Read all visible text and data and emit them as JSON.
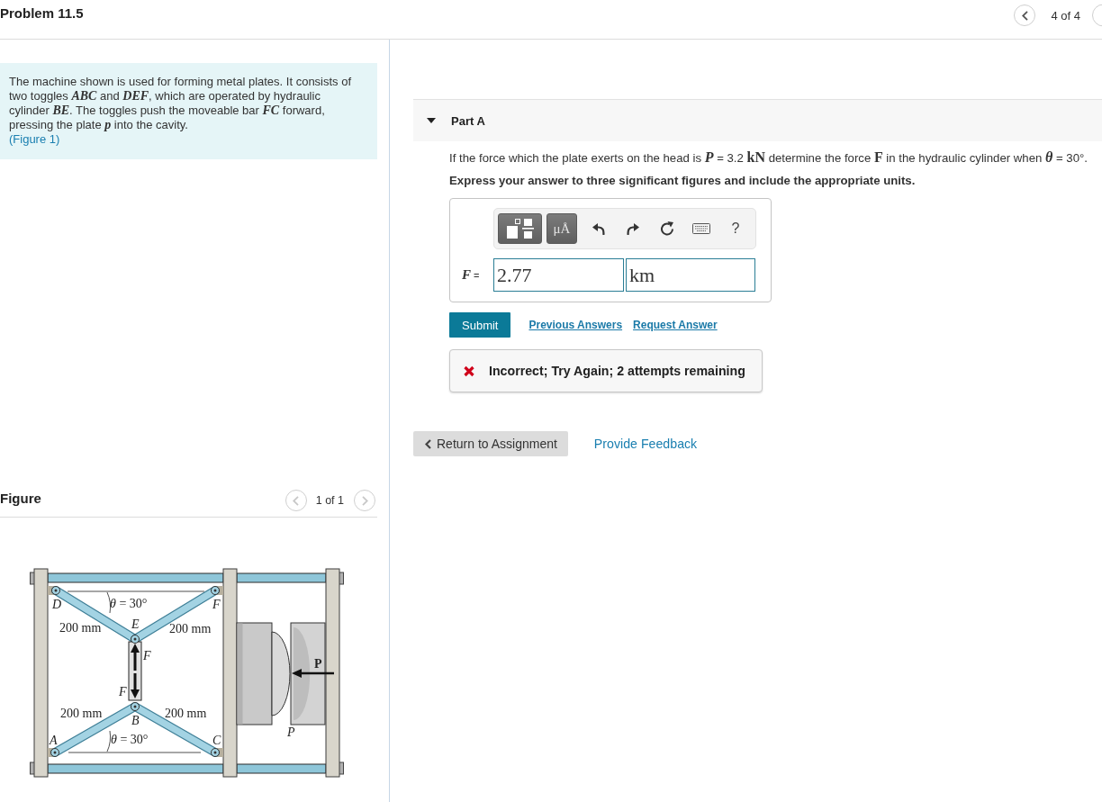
{
  "header": {
    "title": "Problem 11.5",
    "pager": {
      "prev": {
        "disabled": false
      },
      "label": "4 of 4"
    }
  },
  "problem": {
    "statement": "The machine shown is used for forming metal plates. It consists of two toggles *ABC* and *DEF*, which are operated by hydraulic cylinder *BE*. The toggles push the moveable bar *FC* forward, pressing the plate *p* into the cavity.",
    "figure_link": "(Figure 1)"
  },
  "figure": {
    "title": "Figure",
    "pager": {
      "prev": {
        "disabled": true
      },
      "label": "1 of 1",
      "next": {
        "disabled": true
      }
    },
    "labels": [
      {
        "text": "D",
        "kind": "point"
      },
      {
        "text": "*θ* = 30°",
        "kind": "angle"
      },
      {
        "text": "F",
        "kind": "point"
      },
      {
        "text": "E",
        "kind": "point"
      },
      {
        "text": "200 mm",
        "kind": "dimension"
      },
      {
        "text": "200 mm",
        "kind": "dimension"
      },
      {
        "text": "F",
        "kind": "force"
      },
      {
        "text": "P",
        "kind": "load"
      },
      {
        "text": "F",
        "kind": "force"
      },
      {
        "text": "200 mm",
        "kind": "dimension"
      },
      {
        "text": "200 mm",
        "kind": "dimension"
      },
      {
        "text": "B",
        "kind": "point"
      },
      {
        "text": "P",
        "kind": "point"
      },
      {
        "text": "A",
        "kind": "point"
      },
      {
        "text": "*θ* = 30°",
        "kind": "angle"
      },
      {
        "text": "C",
        "kind": "point"
      }
    ]
  },
  "part": {
    "title": "Part A",
    "expanded": true,
    "question": "If the force which the plate exerts on the head is *P* = 3.2 **kN** determine the force **F** in the hydraulic cylinder when *θ* = 30°.",
    "instruction": "Express your answer to three significant figures and include the appropriate units.",
    "toolbar": {
      "units_button": "μÅ",
      "help_button": "?"
    },
    "answer": {
      "label": "*F* =",
      "value": "2.77",
      "units": "km"
    },
    "submit": "Submit",
    "links": [
      "Previous Answers",
      "Request Answer"
    ],
    "feedback": {
      "correct": false,
      "message": "Incorrect; Try Again; 2 attempts remaining"
    }
  },
  "footer": {
    "return_button": "Return to Assignment",
    "feedback_link": "Provide Feedback"
  }
}
